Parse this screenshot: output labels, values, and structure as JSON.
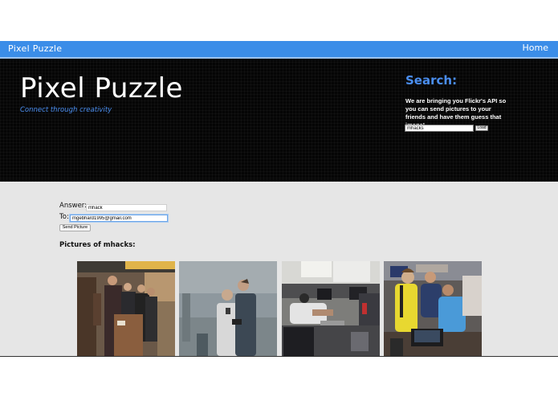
{
  "navbar": {
    "brand": "Pixel Puzzle",
    "home_link": "Home",
    "color": "#3b8de8"
  },
  "hero": {
    "title": "Pixel Puzzle",
    "tagline": "Connect through creativity",
    "search": {
      "heading": "Search:",
      "description": "We are bringing you Flickr's API so you can send pictures to your friends and have them guess that image!",
      "input_value": "mhacks",
      "load_label": "Load"
    }
  },
  "form": {
    "answer_label": "Answer:",
    "answer_value": "mhack",
    "to_label": "To:",
    "to_value": "mgebhard1995@gmail.com",
    "send_label": "Send Picture"
  },
  "pictures": {
    "heading": "Pictures of mhacks:",
    "items": [
      {
        "subject": "people-gathered-around-table"
      },
      {
        "subject": "two-people-looking-at-phone"
      },
      {
        "subject": "person-at-laptop-in-workspace"
      },
      {
        "subject": "group-huddled-over-laptop"
      }
    ]
  },
  "colors": {
    "accent": "#4a8ef0",
    "hero_background": "#050505",
    "content_background": "#e6e6e6"
  }
}
